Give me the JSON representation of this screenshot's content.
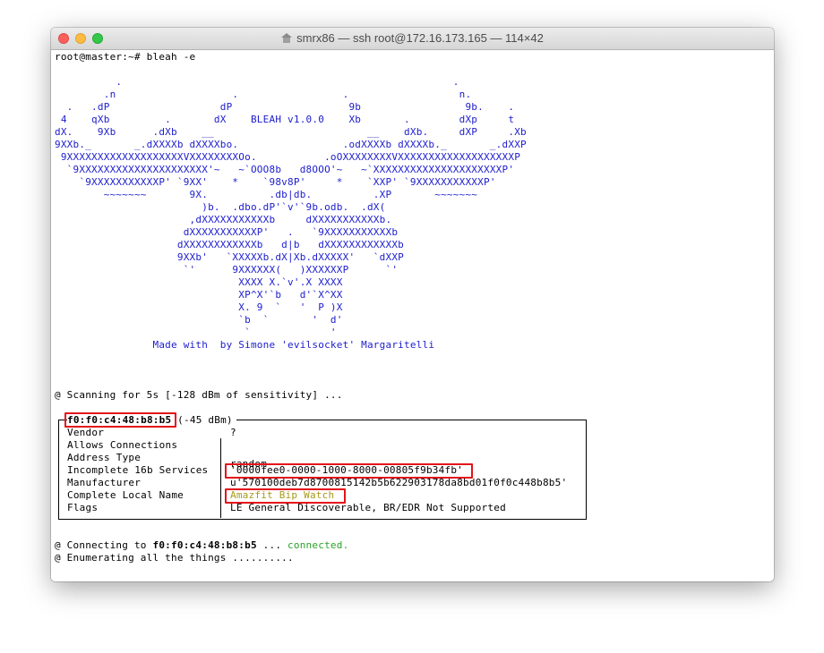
{
  "window": {
    "title": "smrx86 — ssh root@172.16.173.165 — 114×42",
    "home_icon": "house-icon",
    "traffic_lights": [
      "close",
      "minimize",
      "zoom"
    ]
  },
  "terminal": {
    "prompt": "root@master:~# bleah -e",
    "banner": [
      "          .                                                      .",
      "        .n                   .                 .                  n.",
      "  .   .dP                  dP                   9b                 9b.    .",
      " 4    qXb         .       dX    BLEAH v1.0.0    Xb       .        dXp     t",
      "dX.    9Xb      .dXb    __                         __    dXb.     dXP     .Xb",
      "9XXb._       _.dXXXXb dXXXXbo.                 .odXXXXb dXXXXb._       _.dXXP",
      " 9XXXXXXXXXXXXXXXXXXXVXXXXXXXXOo.           .oOXXXXXXXXVXXXXXXXXXXXXXXXXXXXP",
      "  `9XXXXXXXXXXXXXXXXXXXXX'~   ~`OOO8b   d8OOO'~   ~`XXXXXXXXXXXXXXXXXXXXXP'",
      "    `9XXXXXXXXXXXP' `9XX'    *    `98v8P'     *    `XXP' `9XXXXXXXXXXXP'",
      "        ~~~~~~~       9X.          .db|db.          .XP       ~~~~~~~",
      "                        )b.  .dbo.dP'`v'`9b.odb.  .dX(",
      "                      ,dXXXXXXXXXXXb     dXXXXXXXXXXXb.",
      "                     dXXXXXXXXXXXP'   .   `9XXXXXXXXXXXb",
      "                    dXXXXXXXXXXXXb   d|b   dXXXXXXXXXXXXb",
      "                    9XXb'   `XXXXXb.dX|Xb.dXXXXX'   `dXXP",
      "                     `'      9XXXXXX(   )XXXXXXP      `'",
      "                              XXXX X.`v'.X XXXX",
      "                              XP^X'`b   d'`X^XX",
      "                              X. 9  `   '  P )X",
      "                              `b  `       '  d'",
      "                               `             '"
    ],
    "credit": "                Made with  by Simone 'evilsocket' Margaritelli",
    "scanning": "@ Scanning for 5s [-128 dBm of sensitivity] ...",
    "device": {
      "mac": "f0:f0:c4:48:b8:b5",
      "rssi": "(-45 dBm)",
      "rows": [
        {
          "key": "Vendor",
          "value": "?"
        },
        {
          "key": "Allows Connections",
          "value": ""
        },
        {
          "key": "Address Type",
          "value": "random"
        },
        {
          "key": "Incomplete 16b Services",
          "value": "'0000fee0-0000-1000-8000-00805f9b34fb'"
        },
        {
          "key": "Manufacturer",
          "value": "u'570100deb7d8700815142b5b622903178da8bd01f0f0c448b8b5'"
        },
        {
          "key": "Complete Local Name",
          "value": "Amazfit Bip Watch"
        },
        {
          "key": "Flags",
          "value": "LE General Discoverable, BR/EDR Not Supported"
        }
      ]
    },
    "connecting_prefix": "@ Connecting to ",
    "connecting_mac": "f0:f0:c4:48:b8:b5",
    "connecting_mid": " ... ",
    "connected": "connected.",
    "enumerating": "@ Enumerating all the things ..........",
    "colors": {
      "highlight": "#e3141a",
      "ascii": "#1c1cce",
      "connected": "#2aa22a",
      "name": "#a69a1a"
    }
  }
}
